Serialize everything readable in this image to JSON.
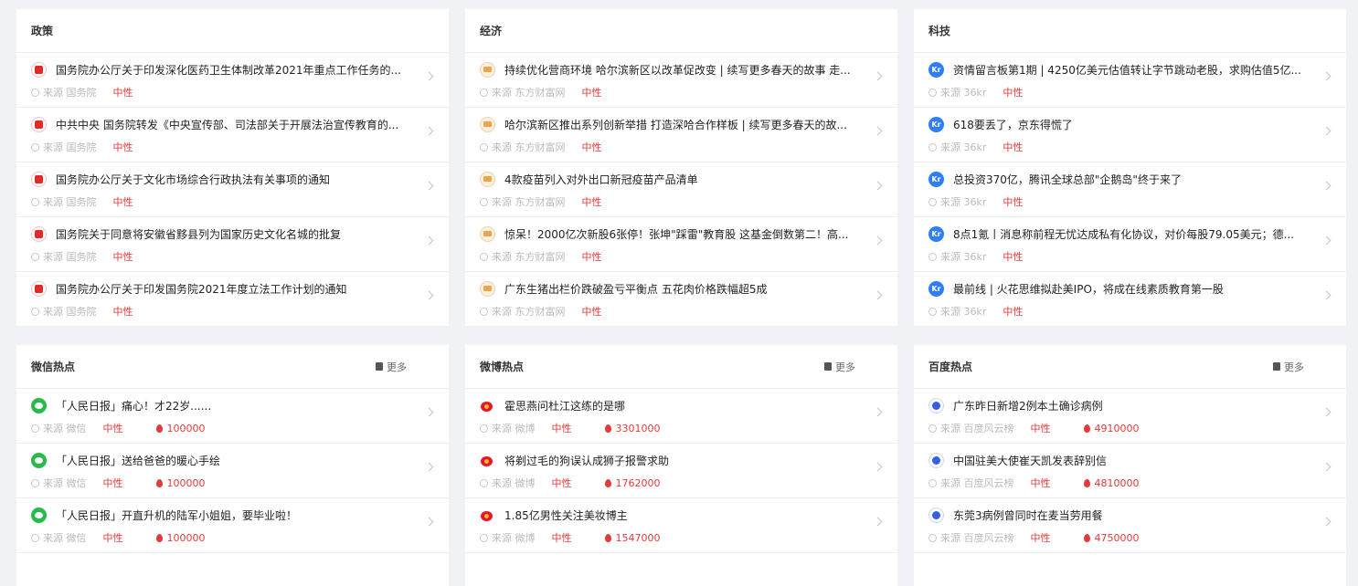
{
  "colors": {
    "accent_red": "#e23b3b",
    "page_bg": "#f0f2f5"
  },
  "panels": [
    {
      "title": "政策",
      "show_more": false,
      "icon": "gov-icon",
      "items": [
        {
          "title": "国务院办公厅关于印发深化医药卫生体制改革2021年重点工作任务的...",
          "source": "来源 国务院",
          "sentiment": "中性"
        },
        {
          "title": "中共中央 国务院转发《中央宣传部、司法部关于开展法治宣传教育的...",
          "source": "来源 国务院",
          "sentiment": "中性"
        },
        {
          "title": "国务院办公厅关于文化市场综合行政执法有关事项的通知",
          "source": "来源 国务院",
          "sentiment": "中性"
        },
        {
          "title": "国务院关于同意将安徽省黟县列为国家历史文化名城的批复",
          "source": "来源 国务院",
          "sentiment": "中性"
        },
        {
          "title": "国务院办公厅关于印发国务院2021年度立法工作计划的通知",
          "source": "来源 国务院",
          "sentiment": "中性"
        }
      ]
    },
    {
      "title": "经济",
      "show_more": false,
      "icon": "eastmoney-icon",
      "items": [
        {
          "title": "持续优化营商环境 哈尔滨新区以改革促改变 | 续写更多春天的故事 走...",
          "source": "来源 东方财富网",
          "sentiment": "中性"
        },
        {
          "title": "哈尔滨新区推出系列创新举措 打造深哈合作样板 | 续写更多春天的故...",
          "source": "来源 东方财富网",
          "sentiment": "中性"
        },
        {
          "title": "4款疫苗列入对外出口新冠疫苗产品清单",
          "source": "来源 东方财富网",
          "sentiment": "中性"
        },
        {
          "title": "惊呆！2000亿次新股6张停！张坤\"踩雷\"教育股 这基金倒数第二！高...",
          "source": "来源 东方财富网",
          "sentiment": "中性"
        },
        {
          "title": "广东生猪出栏价跌破盈亏平衡点 五花肉价格跌幅超5成",
          "source": "来源 东方财富网",
          "sentiment": "中性"
        }
      ]
    },
    {
      "title": "科技",
      "show_more": false,
      "icon": "36kr-icon",
      "icon_text": "Kr",
      "items": [
        {
          "title": "资情留言板第1期 | 4250亿美元估值转让字节跳动老股，求购估值5亿...",
          "source": "来源 36kr",
          "sentiment": "中性"
        },
        {
          "title": "618要丢了，京东得慌了",
          "source": "来源 36kr",
          "sentiment": "中性"
        },
        {
          "title": "总投资370亿，腾讯全球总部\"企鹅岛\"终于来了",
          "source": "来源 36kr",
          "sentiment": "中性"
        },
        {
          "title": "8点1氪丨消息称前程无忧达成私有化协议，对价每股79.05美元；德...",
          "source": "来源 36kr",
          "sentiment": "中性"
        },
        {
          "title": "最前线 | 火花思维拟赴美IPO，将成在线素质教育第一股",
          "source": "来源 36kr",
          "sentiment": "中性"
        }
      ]
    },
    {
      "title": "微信热点",
      "show_more": true,
      "more_label": "更多",
      "icon": "wechat-icon",
      "items": [
        {
          "title": "「人民日报」痛心！才22岁......",
          "source": "来源 微信",
          "sentiment": "中性",
          "heat": "100000"
        },
        {
          "title": "「人民日报」送给爸爸的暖心手绘",
          "source": "来源 微信",
          "sentiment": "中性",
          "heat": "100000"
        },
        {
          "title": "「人民日报」开直升机的陆军小姐姐，要毕业啦！",
          "source": "来源 微信",
          "sentiment": "中性",
          "heat": "100000"
        }
      ]
    },
    {
      "title": "微博热点",
      "show_more": true,
      "more_label": "更多",
      "icon": "weibo-icon",
      "items": [
        {
          "title": "霍思燕问杜江这练的是哪",
          "source": "来源 微博",
          "sentiment": "中性",
          "heat": "3301000"
        },
        {
          "title": "将剃过毛的狗误认成狮子报警求助",
          "source": "来源 微博",
          "sentiment": "中性",
          "heat": "1762000"
        },
        {
          "title": "1.85亿男性关注美妆博主",
          "source": "来源 微博",
          "sentiment": "中性",
          "heat": "1547000"
        }
      ]
    },
    {
      "title": "百度热点",
      "show_more": true,
      "more_label": "更多",
      "icon": "baidu-icon",
      "items": [
        {
          "title": "广东昨日新增2例本土确诊病例",
          "source": "来源 百度风云榜",
          "sentiment": "中性",
          "heat": "4910000"
        },
        {
          "title": "中国驻美大使崔天凯发表辞别信",
          "source": "来源 百度风云榜",
          "sentiment": "中性",
          "heat": "4810000"
        },
        {
          "title": "东莞3病例曾同时在麦当劳用餐",
          "source": "来源 百度风云榜",
          "sentiment": "中性",
          "heat": "4750000"
        }
      ]
    }
  ]
}
